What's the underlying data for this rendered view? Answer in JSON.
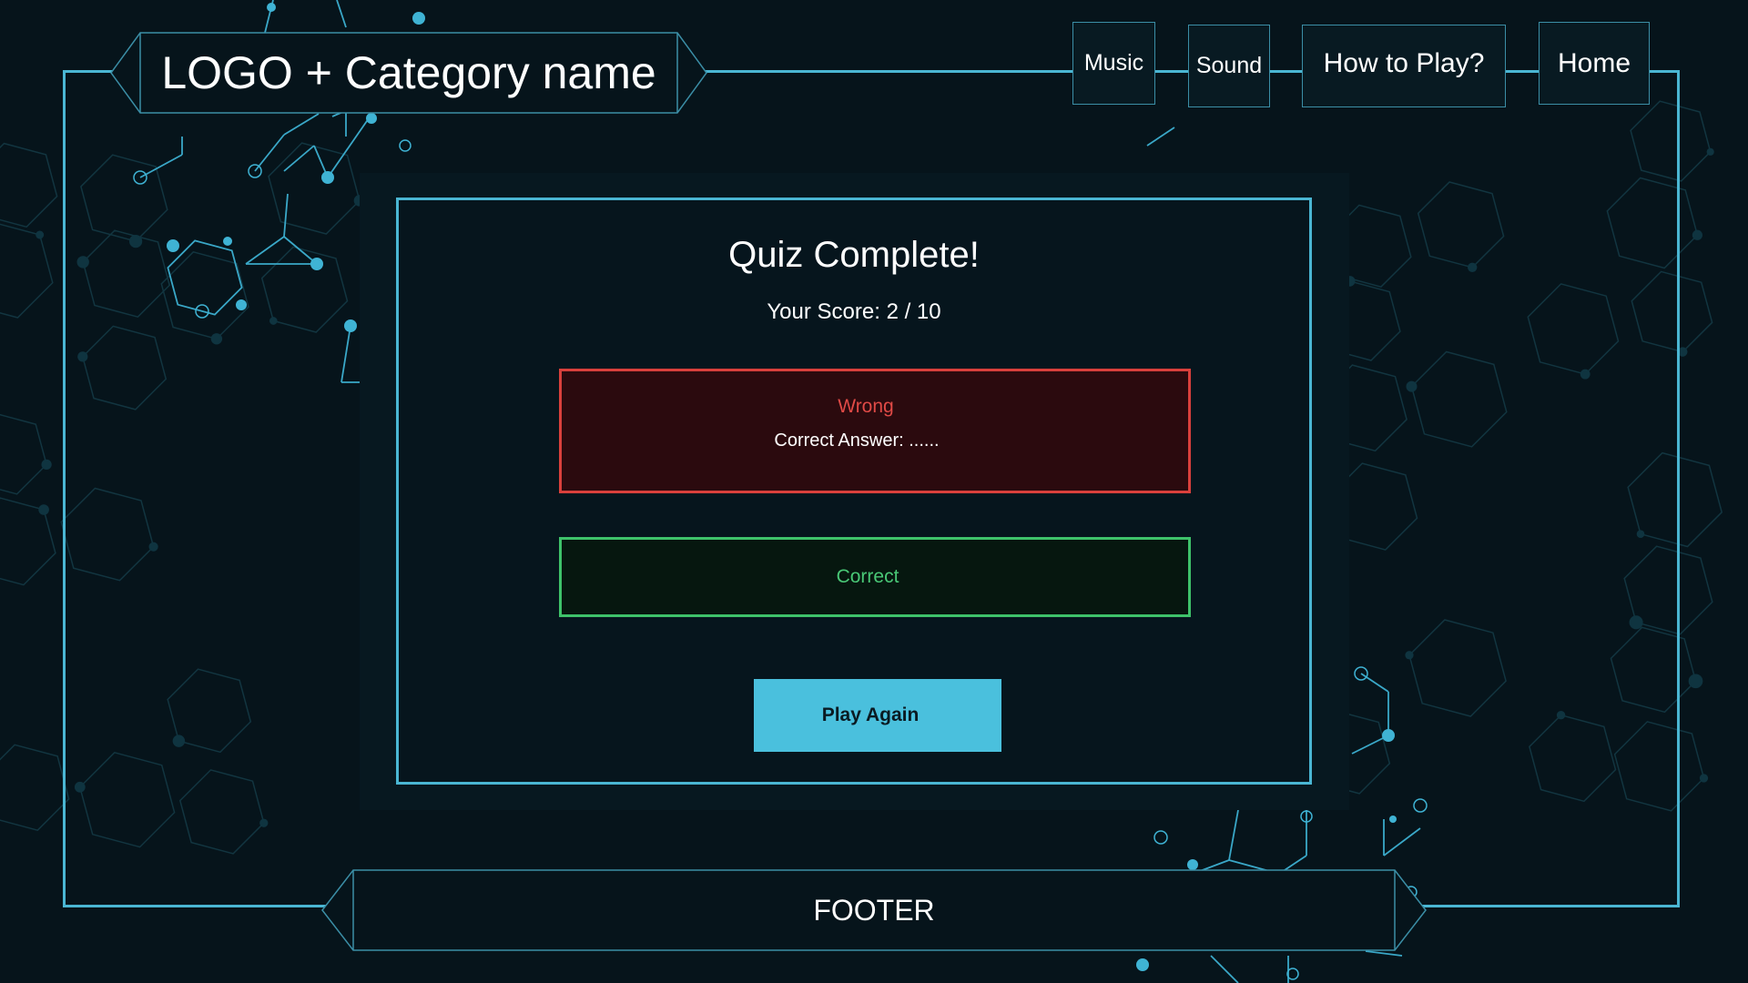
{
  "header": {
    "logo_text": "LOGO + Category name"
  },
  "nav": {
    "music": "Music",
    "sound": "Sound",
    "how_to_play": "How to Play?",
    "home": "Home"
  },
  "result": {
    "title": "Quiz Complete!",
    "score": "Your Score: 2 / 10",
    "wrong": {
      "status": "Wrong",
      "answer": "Correct Answer: ......"
    },
    "correct": {
      "status": "Correct"
    },
    "play_again": "Play Again"
  },
  "footer": {
    "text": "FOOTER"
  },
  "colors": {
    "background": "#06141b",
    "accent": "#4ab6d3",
    "wrong": "#d9403c",
    "correct": "#3ec26a",
    "button": "#4ac0dd"
  }
}
